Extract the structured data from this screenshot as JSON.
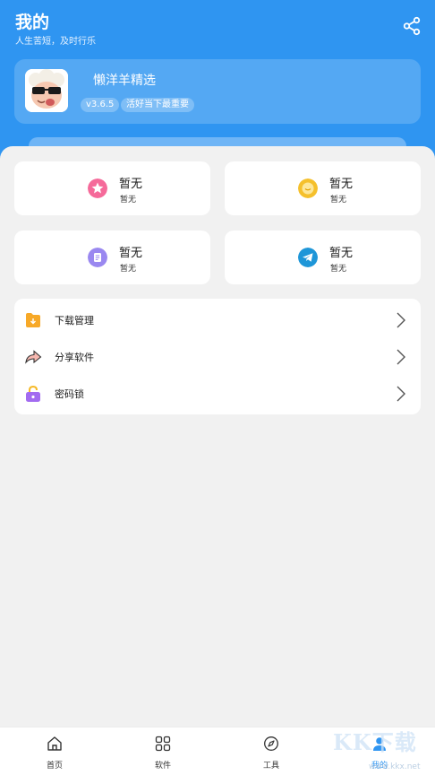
{
  "header": {
    "title": "我的",
    "subtitle": "人生苦短，及时行乐",
    "share_icon": "share-icon",
    "color": "#2f95f1"
  },
  "profile": {
    "name": "懒洋羊精选",
    "version": "v3.6.5",
    "slogan": "活好当下最重要",
    "avatar_icon": "cartoon-sheep-sunglasses-avatar"
  },
  "cards": [
    {
      "title": "暂无",
      "subtitle": "暂无",
      "icon": "pink-star-icon",
      "color": "#f56a9a"
    },
    {
      "title": "暂无",
      "subtitle": "暂无",
      "icon": "yellow-chat-icon",
      "color": "#f5c02c"
    },
    {
      "title": "暂无",
      "subtitle": "暂无",
      "icon": "purple-document-icon",
      "color": "#9a88f0"
    },
    {
      "title": "暂无",
      "subtitle": "暂无",
      "icon": "telegram-icon",
      "color": "#1e96d8"
    }
  ],
  "menu": [
    {
      "label": "下载管理",
      "icon": "download-folder-icon",
      "color": "#f7a928"
    },
    {
      "label": "分享软件",
      "icon": "share-arrow-icon",
      "color": "#e87a7a"
    },
    {
      "label": "密码锁",
      "icon": "lock-icon",
      "color": "#a26bf0"
    }
  ],
  "nav": [
    {
      "label": "首页",
      "icon": "home-icon"
    },
    {
      "label": "软件",
      "icon": "grid-icon"
    },
    {
      "label": "工具",
      "icon": "compass-icon"
    },
    {
      "label": "我的",
      "icon": "profile-icon",
      "active": true
    }
  ],
  "watermark": {
    "text": "KK下载",
    "url": "www.kkx.net"
  }
}
